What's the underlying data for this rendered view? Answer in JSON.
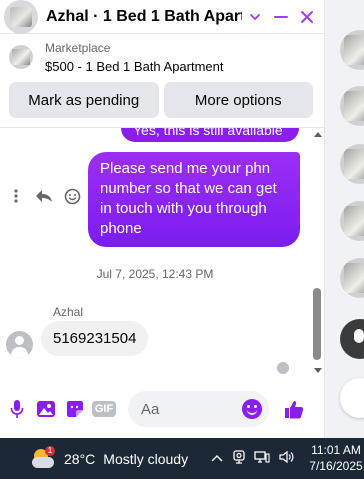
{
  "window": {
    "title": "Azhal · 1 Bed 1 Bath Apart…",
    "accent": "#8a1ef0"
  },
  "listing": {
    "label": "Marketplace",
    "name": "$500 - 1 Bed 1 Bath Apartment"
  },
  "actions": {
    "pending": "Mark as pending",
    "more": "More options"
  },
  "messages": {
    "previous_partial": "Yes, this is still available",
    "sent": "Please send me your phn number so that we can get in touch with you through phone",
    "timestamp": "Jul 7, 2025, 12:43 PM",
    "sender": "Azhal",
    "received": "5169231504"
  },
  "composer": {
    "placeholder": "Aa",
    "gif_label": "GIF"
  },
  "taskbar": {
    "notification_count": "1",
    "temperature": "28°C",
    "condition": "Mostly cloudy",
    "time": "11:01 AM",
    "date": "7/16/2025"
  },
  "icons": {
    "header": [
      "chevron-down-icon",
      "minimize-icon",
      "close-icon"
    ],
    "message_tools": [
      "more-icon",
      "reply-icon",
      "react-icon"
    ],
    "composer": [
      "microphone-icon",
      "photo-icon",
      "sticker-icon",
      "gif-icon",
      "emoji-icon",
      "like-icon"
    ],
    "tray": [
      "chevron-up-icon",
      "webcam-icon",
      "network-icon",
      "volume-icon"
    ]
  }
}
